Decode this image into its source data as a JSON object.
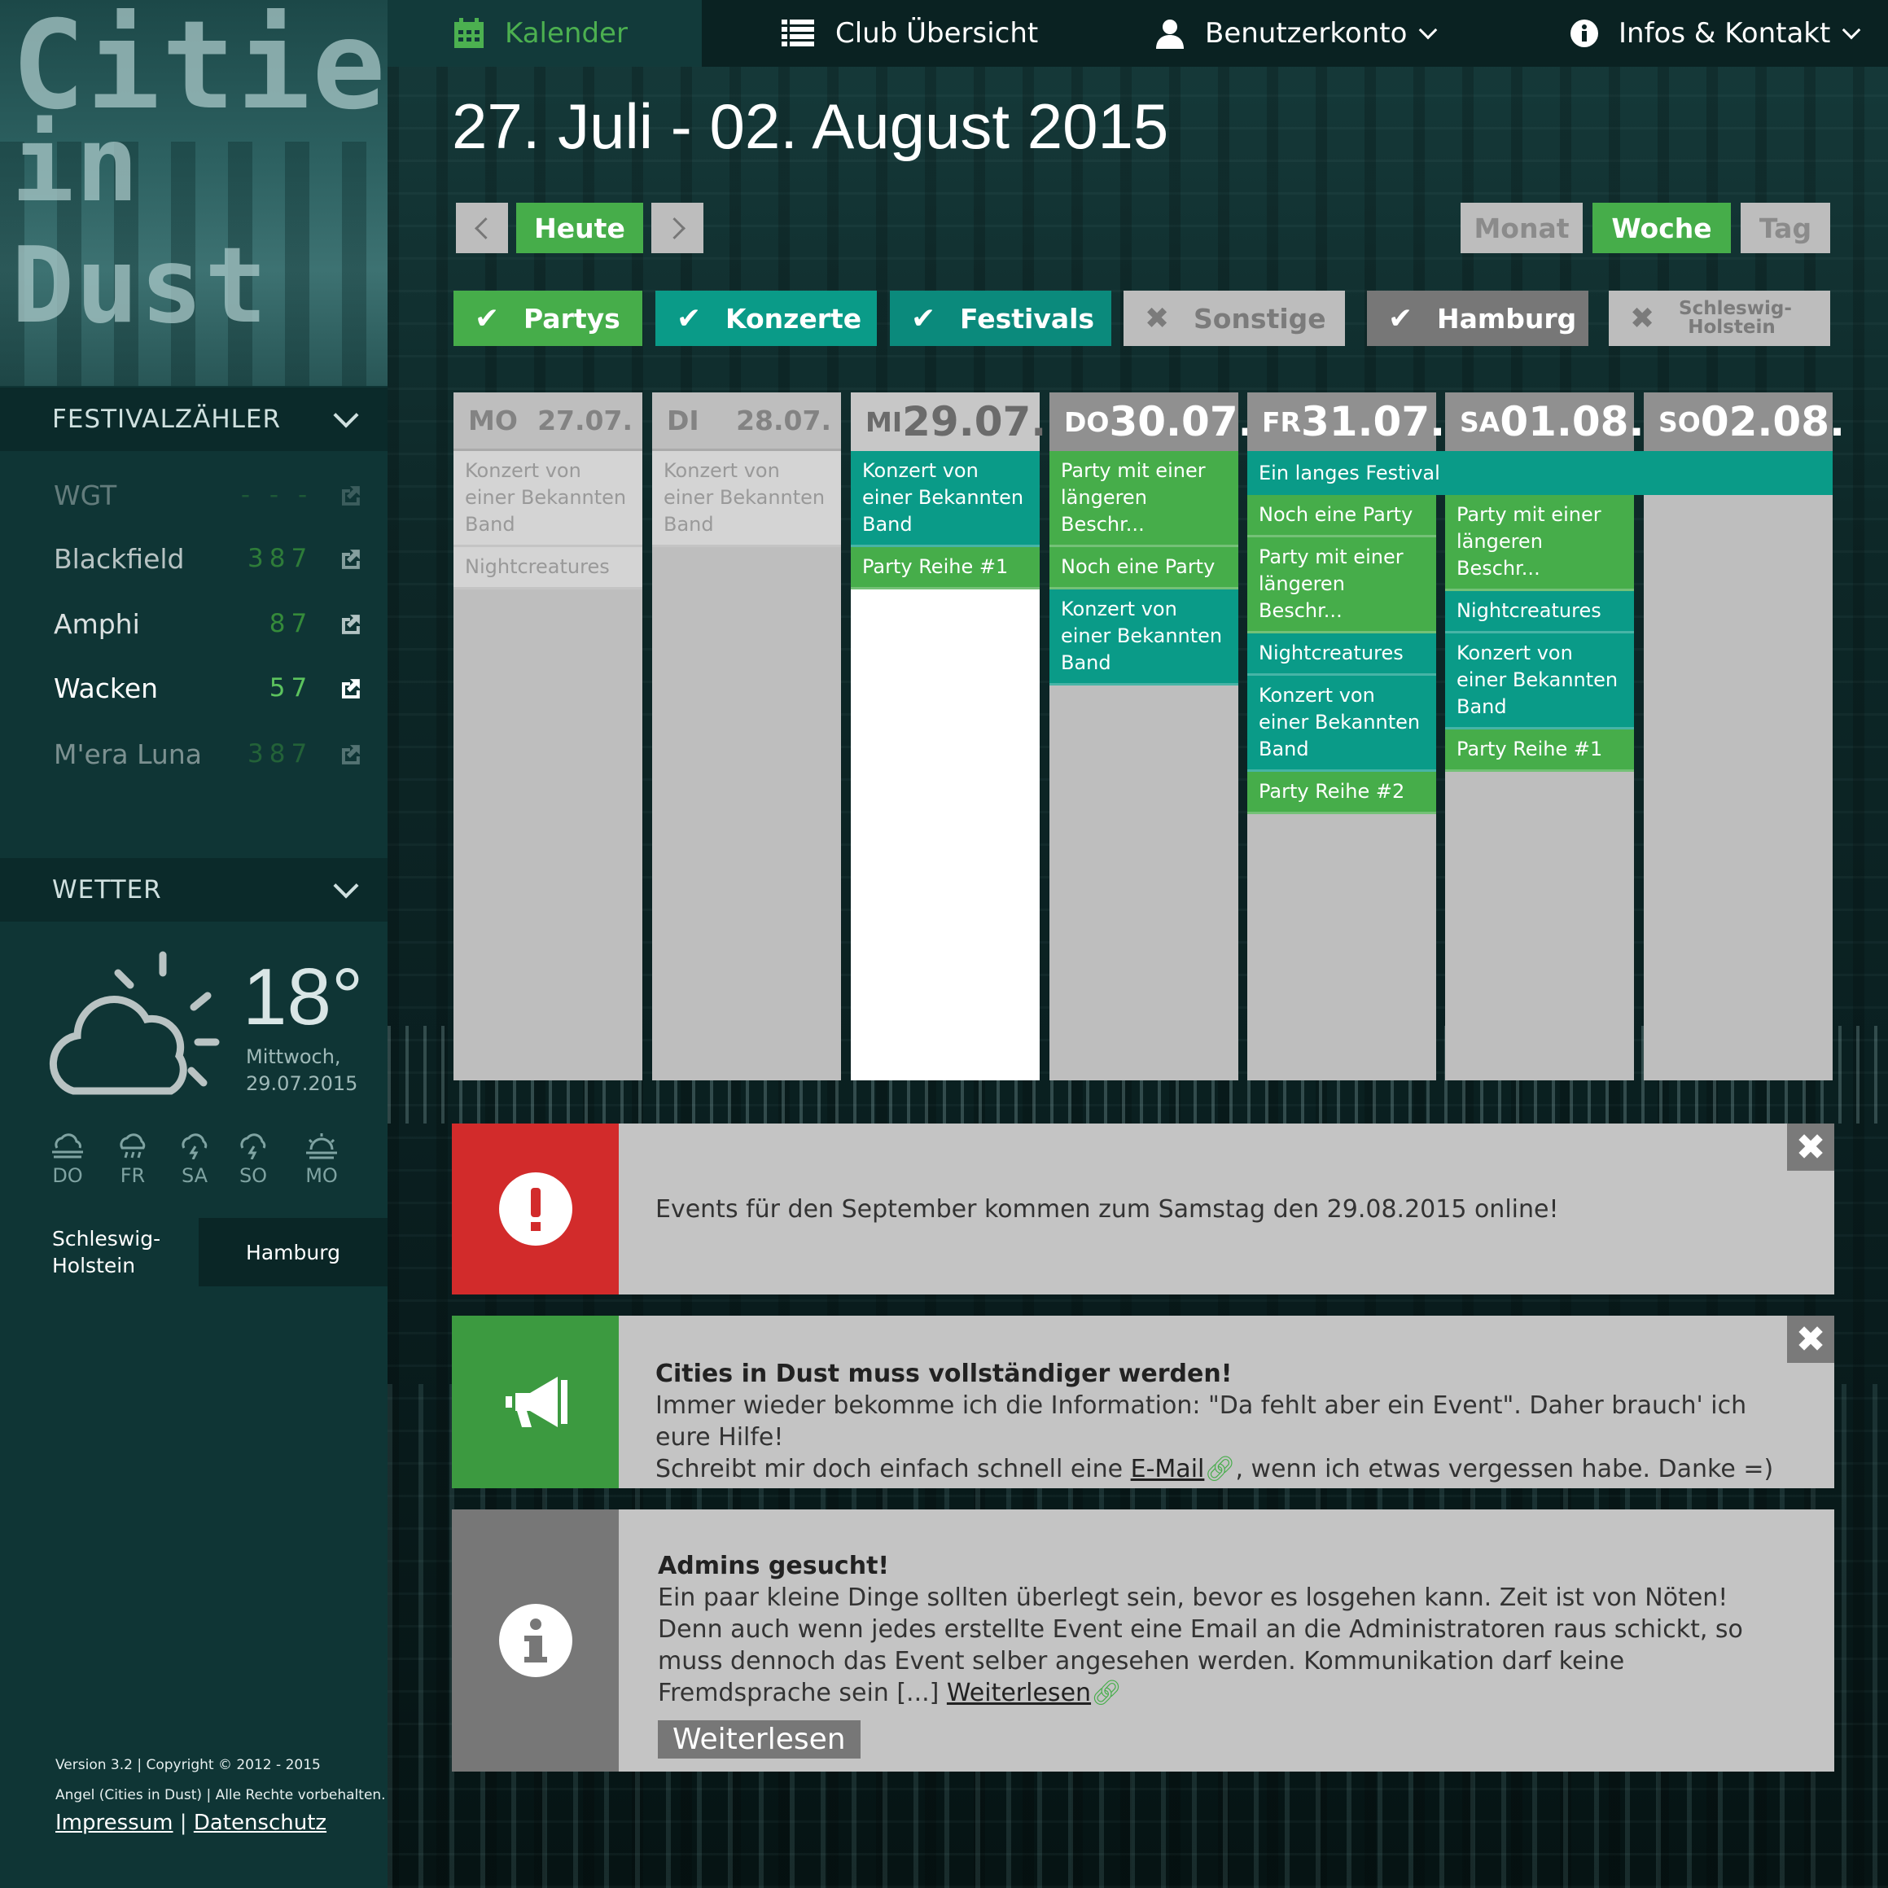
{
  "logo": {
    "line1": "Cities",
    "line2": "in Dust"
  },
  "nav": {
    "kalender": "Kalender",
    "club": "Club Übersicht",
    "account": "Benutzerkonto",
    "info": "Infos & Kontakt"
  },
  "week_title": "27. Juli - 02. August 2015",
  "controls": {
    "prev": "",
    "today": "Heute",
    "next": "",
    "month": "Monat",
    "week": "Woche",
    "day": "Tag"
  },
  "filters": [
    {
      "label": "Partys",
      "checked": true
    },
    {
      "label": "Konzerte",
      "checked": true
    },
    {
      "label": "Festivals",
      "checked": true
    },
    {
      "label": "Sonstige",
      "checked": false
    },
    {
      "label": "Hamburg",
      "checked": true
    },
    {
      "label": "Schleswig-Holstein",
      "checked": false
    }
  ],
  "festival_counter": {
    "title": "FESTIVALZÄHLER",
    "items": [
      {
        "name": "WGT",
        "count": "- - -"
      },
      {
        "name": "Blackfield",
        "count": "387"
      },
      {
        "name": "Amphi",
        "count": "87"
      },
      {
        "name": "Wacken",
        "count": "57"
      },
      {
        "name": "M'era Luna",
        "count": "387"
      }
    ]
  },
  "weather": {
    "title": "WETTER",
    "temp": "18°",
    "day": "Mittwoch,",
    "date": "29.07.2015",
    "forecast": [
      "DO",
      "FR",
      "SA",
      "SO",
      "MO"
    ],
    "loc_a": "Schleswig-Holstein",
    "loc_b": "Hamburg"
  },
  "footer": {
    "version": "Version 3.2 | Copyright © 2012 - 2015",
    "rights": "Angel (Cities in Dust) | Alle Rechte vorbehalten.",
    "impressum": "Impressum",
    "sep": "|",
    "privacy": "Datenschutz"
  },
  "days": [
    {
      "d": "MO",
      "date": "27.07.",
      "events": [
        {
          "t": "Konzert von einer Bekannten Band"
        },
        {
          "t": "Nightcreatures"
        }
      ]
    },
    {
      "d": "DI",
      "date": "28.07.",
      "events": [
        {
          "t": "Konzert von einer Bekannten Band"
        }
      ]
    },
    {
      "d": "MI",
      "date": "29.07.",
      "events": [
        {
          "t": "Konzert von einer Bekannten Band"
        },
        {
          "t": "Party Reihe #1"
        }
      ]
    },
    {
      "d": "DO",
      "date": "30.07.",
      "events": [
        {
          "t": "Party mit einer längeren Beschr..."
        },
        {
          "t": "Noch eine Party"
        },
        {
          "t": "Konzert von einer Bekannten Band"
        }
      ]
    },
    {
      "d": "FR",
      "date": "31.07.",
      "events": [
        {
          "t": "Noch eine Party"
        },
        {
          "t": "Party mit einer längeren Beschr..."
        },
        {
          "t": "Nightcreatures"
        },
        {
          "t": "Konzert von einer Bekannten Band"
        },
        {
          "t": "Party Reihe #2"
        }
      ]
    },
    {
      "d": "SA",
      "date": "01.08.",
      "events": [
        {
          "t": "Party mit einer längeren Beschr..."
        },
        {
          "t": "Nightcreatures"
        },
        {
          "t": "Konzert von einer Bekannten Band"
        },
        {
          "t": "Party Reihe #1"
        }
      ]
    },
    {
      "d": "SO",
      "date": "02.08.",
      "events": []
    }
  ],
  "festival_bar": "Ein langes Festival",
  "alerts": {
    "warn": "Events für den September kommen zum Samstag den 29.08.2015 online!",
    "notice_title": "Cities in Dust muss vollständiger werden!",
    "notice_l1": "Immer wieder bekomme ich die Information: \"Da fehlt aber ein Event\". Daher brauch' ich eure Hilfe!",
    "notice_l2a": "Schreibt mir doch einfach schnell eine ",
    "notice_link": "E-Mail",
    "notice_l2b": ", wenn ich etwas vergessen habe. Danke =)",
    "info_title": "Admins gesucht!",
    "info_text": "Ein paar kleine Dinge sollten überlegt sein, bevor es losgehen kann. Zeit ist von Nöten! Denn auch wenn jedes erstellte Event eine Email an die Administratoren raus schickt, so muss dennoch das Event selber angesehen werden. Kommunikation darf keine Fremdsprache sein [...] ",
    "info_link": "Weiterlesen",
    "info_button": "Weiterlesen",
    "close": "✖"
  },
  "colors": {
    "green": "#46ad4a",
    "teal": "#0a9b88",
    "red": "#d22b2b",
    "grey": "#bebebe"
  }
}
